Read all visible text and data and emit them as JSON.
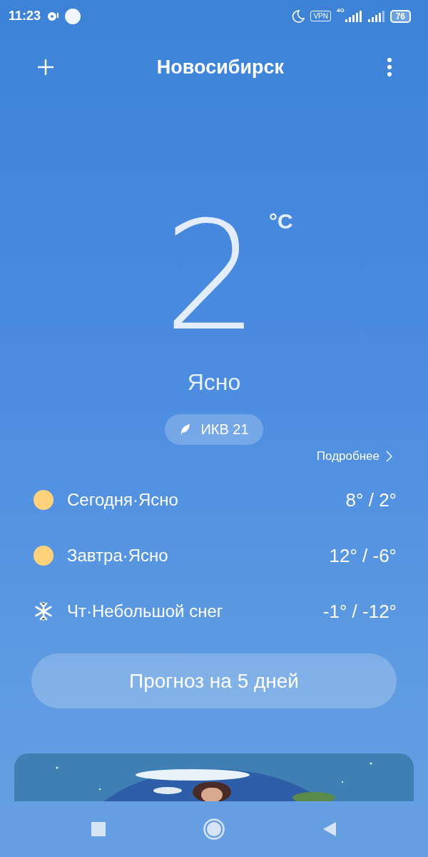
{
  "status_bar": {
    "time": "11:23",
    "vpn": "VPN",
    "network": "4G",
    "battery": "76"
  },
  "header": {
    "title": "Новосибирск"
  },
  "current": {
    "temperature": "2",
    "unit": "°C",
    "condition": "Ясно",
    "aqi": "ИКВ 21"
  },
  "details_link": "Подробнее",
  "forecast": [
    {
      "kind": "sun",
      "day": "Сегодня",
      "separator": "·",
      "condition": "Ясно",
      "temps": "8° / 2°"
    },
    {
      "kind": "sun",
      "day": "Завтра",
      "separator": "·",
      "condition": "Ясно",
      "temps": "12° / -6°"
    },
    {
      "kind": "snow",
      "day": "Чт",
      "separator": "·",
      "condition": "Небольшой снег",
      "temps": "-1° / -12°"
    }
  ],
  "forecast_button": "Прогноз на 5 дней"
}
